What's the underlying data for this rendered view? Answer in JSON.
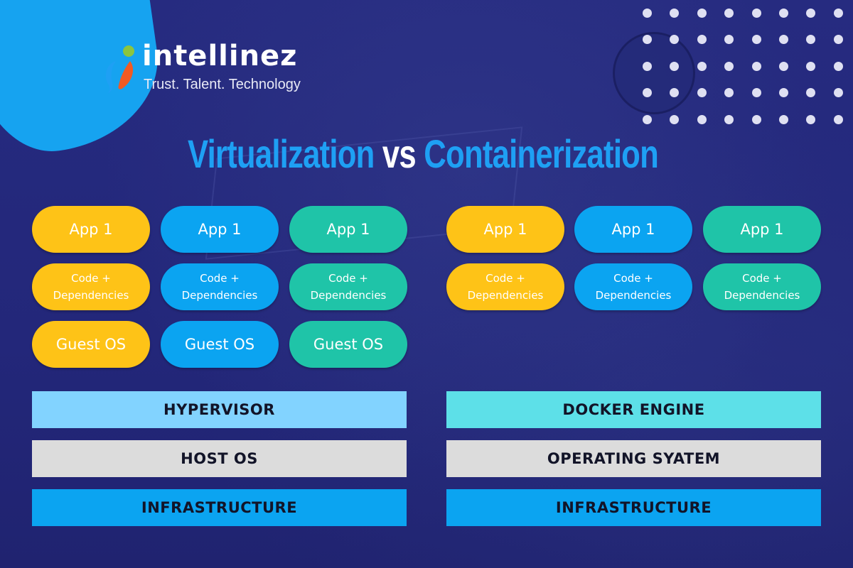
{
  "brand": {
    "name": "intellinez",
    "tagline": "Trust. Talent. Technology"
  },
  "title": {
    "left": "Virtualization",
    "middle": "vs",
    "right": "Containerization"
  },
  "colors": {
    "background": "#24287a",
    "title_accent": "#1ea0f4",
    "yellow": "#fec317",
    "blue": "#0ba4f1",
    "teal": "#1fc4a8",
    "hypervisor": "#82d3ff",
    "docker_engine": "#5de0e8",
    "os_gray": "#dcdcdc",
    "infrastructure": "#0ba4f1",
    "logo_green": "#8bc53f",
    "logo_orange": "#f15a24",
    "logo_blue": "#1ea0f4"
  },
  "virtualization": {
    "stacks": [
      {
        "color": "yellow",
        "app": "App 1",
        "code": [
          "Code +",
          "Dependencies"
        ],
        "guest_os": "Guest OS"
      },
      {
        "color": "blue",
        "app": "App 1",
        "code": [
          "Code +",
          "Dependencies"
        ],
        "guest_os": "Guest OS"
      },
      {
        "color": "teal",
        "app": "App 1",
        "code": [
          "Code +",
          "Dependencies"
        ],
        "guest_os": "Guest OS"
      }
    ],
    "layers": [
      {
        "label": "HYPERVISOR",
        "color": "#82d3ff"
      },
      {
        "label": "HOST OS",
        "color": "#dcdcdc"
      },
      {
        "label": "INFRASTRUCTURE",
        "color": "#0ba4f1"
      }
    ]
  },
  "containerization": {
    "stacks": [
      {
        "color": "yellow",
        "app": "App 1",
        "code": [
          "Code +",
          "Dependencies"
        ]
      },
      {
        "color": "blue",
        "app": "App 1",
        "code": [
          "Code +",
          "Dependencies"
        ]
      },
      {
        "color": "teal",
        "app": "App 1",
        "code": [
          "Code +",
          "Dependencies"
        ]
      }
    ],
    "layers": [
      {
        "label": "DOCKER ENGINE",
        "color": "#5de0e8"
      },
      {
        "label": "OPERATING SYATEM",
        "color": "#dcdcdc"
      },
      {
        "label": "INFRASTRUCTURE",
        "color": "#0ba4f1"
      }
    ]
  }
}
